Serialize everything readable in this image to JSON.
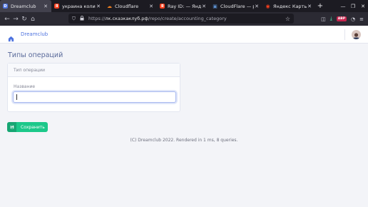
{
  "browser": {
    "tabs": [
      {
        "title": "Dreamclub",
        "favicon_letter": "D",
        "favicon_color": "#4e73df",
        "active": true
      },
      {
        "title": "украина количество",
        "favicon_letter": "Я",
        "favicon_color": "#fc3f1d",
        "active": false
      },
      {
        "title": "Cloudflare",
        "favicon_letter": "☁",
        "favicon_color": "#f38020",
        "active": false
      },
      {
        "title": "Ray ID: — Яндекс",
        "favicon_letter": "Я",
        "favicon_color": "#fc3f1d",
        "active": false
      },
      {
        "title": "CloudFlare — ран",
        "favicon_letter": "▣",
        "favicon_color": "#5b8cc9",
        "active": false
      },
      {
        "title": "Яндекс Карты",
        "favicon_letter": "◉",
        "favicon_color": "#fc3f1d",
        "active": false
      }
    ],
    "new_tab_label": "+",
    "url_prefix": "https://",
    "url_host": "лк.сказкаклуб.рф",
    "url_path": "/repo/create/accounting_category",
    "abp_label": "ABP"
  },
  "header": {
    "brand": "Dreamclub",
    "accent_color": "#4e73df"
  },
  "page": {
    "title": "Типы операций",
    "card_header": "Тип операции",
    "field_label": "Название",
    "field_value": "",
    "save_label": "Сохранить",
    "save_color": "#1cc88a"
  },
  "footer": {
    "text": "(C) Dreamclub 2022. Rendered in 1 ms, 8 queries."
  }
}
